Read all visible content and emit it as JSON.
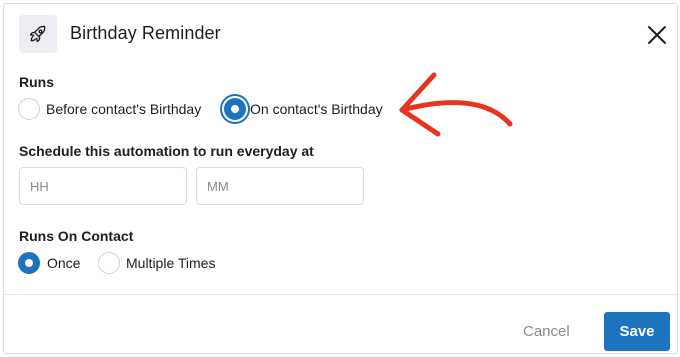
{
  "header": {
    "title": "Birthday Reminder",
    "icon": "rocket-icon",
    "close_icon": "close-icon"
  },
  "runs": {
    "label": "Runs",
    "options": [
      {
        "label": "Before contact's Birthday",
        "checked": false
      },
      {
        "label": "On contact's Birthday",
        "checked": true
      }
    ]
  },
  "schedule": {
    "label": "Schedule this automation to run everyday at",
    "hour_placeholder": "HH",
    "minute_placeholder": "MM"
  },
  "runs_on_contact": {
    "label": "Runs On Contact",
    "options": [
      {
        "label": "Once",
        "checked": true
      },
      {
        "label": "Multiple Times",
        "checked": false
      }
    ]
  },
  "footer": {
    "cancel_label": "Cancel",
    "save_label": "Save"
  },
  "colors": {
    "accent": "#1e73be",
    "annotation_arrow": "#e8331f"
  }
}
